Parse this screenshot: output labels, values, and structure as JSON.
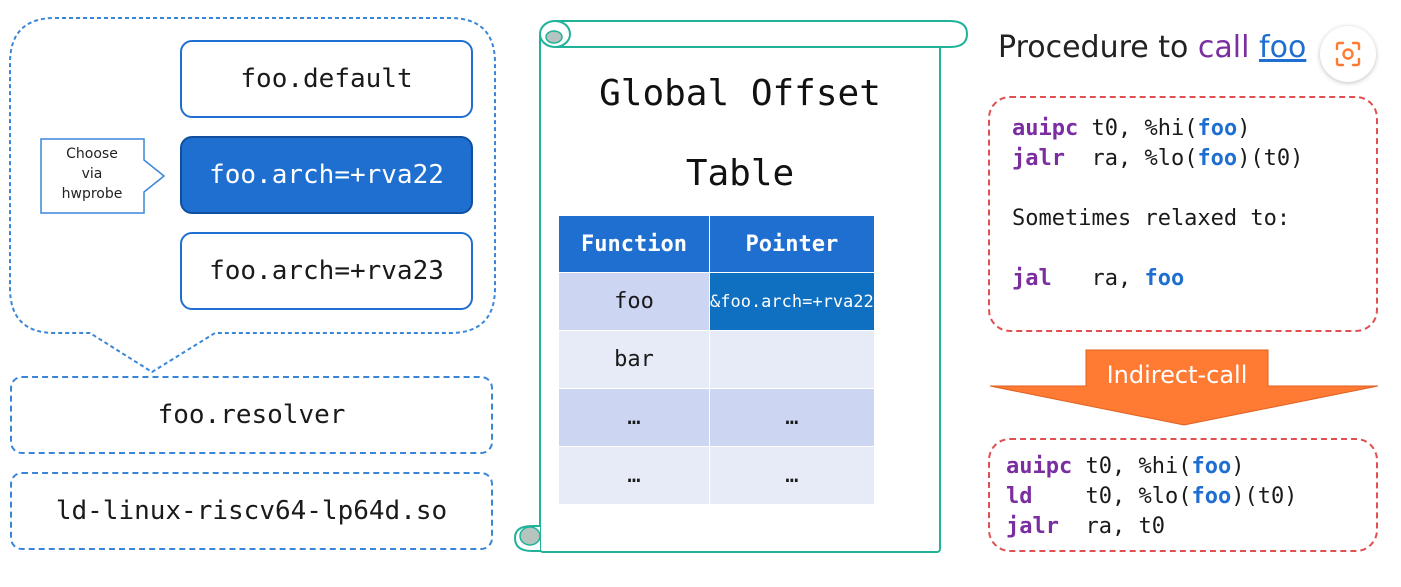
{
  "ifunc_variants": {
    "default": "foo.default",
    "rva22": "foo.arch=+rva22",
    "rva23": "foo.arch=+rva23"
  },
  "choose_label": {
    "line1": "Choose",
    "line2": "via",
    "line3": "hwprobe"
  },
  "resolver_label": "foo.resolver",
  "loader_label": "ld-linux-riscv64-lp64d.so",
  "got": {
    "title_line1": "Global Offset",
    "title_line2": "Table",
    "headers": [
      "Function",
      "Pointer"
    ],
    "rows": [
      [
        "foo",
        "&foo.arch=+rva22"
      ],
      [
        "bar",
        ""
      ],
      [
        "…",
        "…"
      ],
      [
        "…",
        "…"
      ]
    ]
  },
  "procedure": {
    "title_prefix": "Procedure to ",
    "title_call": "call",
    "title_sym": "foo"
  },
  "direct_code": [
    [
      {
        "t": "auipc",
        "c": "kw"
      },
      {
        "t": " t0, %hi("
      },
      {
        "t": "foo",
        "c": "sym"
      },
      {
        "t": ")"
      }
    ],
    [
      {
        "t": "jalr",
        "c": "kw"
      },
      {
        "t": "  ra, %lo("
      },
      {
        "t": "foo",
        "c": "sym"
      },
      {
        "t": ")(t0)"
      }
    ],
    [],
    [
      {
        "t": "Sometimes relaxed to:"
      }
    ],
    [],
    [
      {
        "t": "jal",
        "c": "kw"
      },
      {
        "t": "   ra, "
      },
      {
        "t": "foo",
        "c": "sym"
      }
    ]
  ],
  "arrow_label": "Indirect-call",
  "indirect_code": [
    [
      {
        "t": "auipc",
        "c": "kw"
      },
      {
        "t": " t0, %hi("
      },
      {
        "t": "foo",
        "c": "sym"
      },
      {
        "t": ")"
      }
    ],
    [
      {
        "t": "ld",
        "c": "kw"
      },
      {
        "t": "    t0, %lo("
      },
      {
        "t": "foo",
        "c": "sym"
      },
      {
        "t": ")(t0)"
      }
    ],
    [
      {
        "t": "jalr",
        "c": "kw"
      },
      {
        "t": "  ra, t0"
      }
    ]
  ],
  "colors": {
    "accent_blue": "#1f6fd1",
    "keyword_purple": "#7a2ea0",
    "arrow_orange": "#ff7a33",
    "code_border_red": "#e05050",
    "scroll_teal": "#20b39a"
  }
}
